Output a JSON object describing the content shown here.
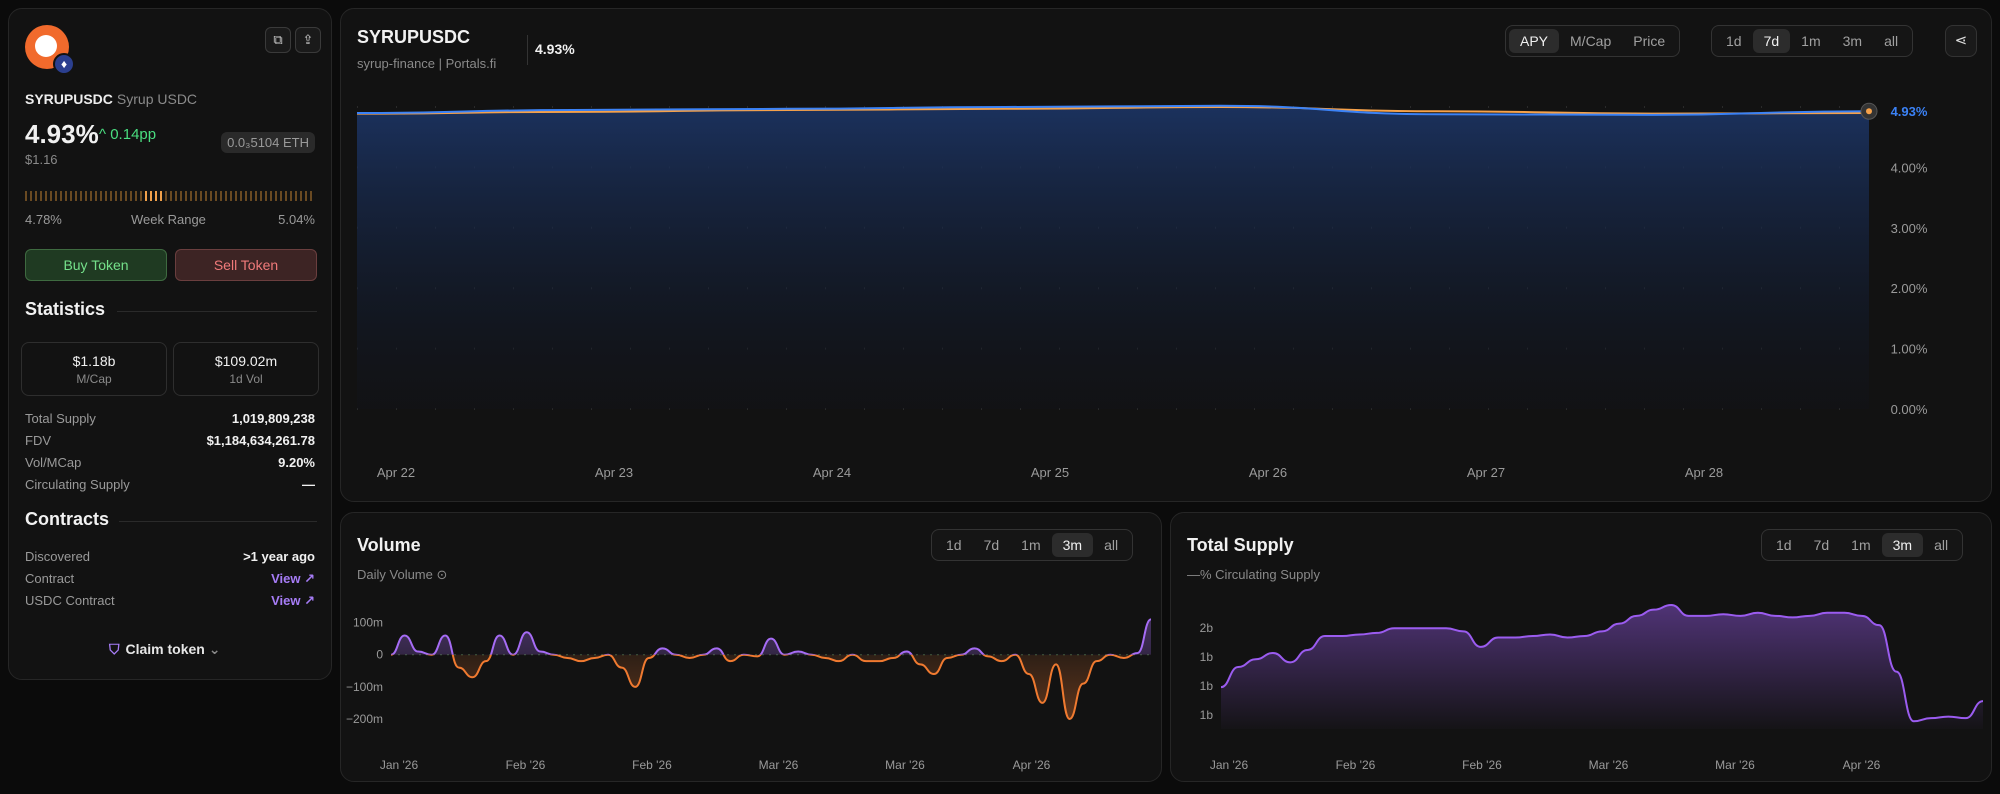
{
  "token": {
    "symbol": "SYRUPUSDC",
    "name": "Syrup USDC",
    "apy": "4.93%",
    "delta": "0.14pp",
    "price": "$1.16",
    "eth_price": "0.0₃5104 ETH",
    "week_low": "4.78%",
    "week_label": "Week Range",
    "week_high": "5.04%",
    "buy_label": "Buy Token",
    "sell_label": "Sell Token"
  },
  "statistics": {
    "heading": "Statistics",
    "mcap_value": "$1.18b",
    "mcap_label": "M/Cap",
    "vol_value": "$109.02m",
    "vol_label": "1d Vol",
    "rows": [
      {
        "k": "Total Supply",
        "v": "1,019,809,238"
      },
      {
        "k": "FDV",
        "v": "$1,184,634,261.78"
      },
      {
        "k": "Vol/MCap",
        "v": "9.20%"
      },
      {
        "k": "Circulating Supply",
        "v": "—"
      }
    ]
  },
  "contracts": {
    "heading": "Contracts",
    "rows": [
      {
        "k": "Discovered",
        "v": ">1 year ago"
      },
      {
        "k": "Contract",
        "v": "View ↗"
      },
      {
        "k": "USDC Contract",
        "v": "View ↗"
      }
    ],
    "claim_label": "Claim token"
  },
  "main_chart": {
    "title": "SYRUPUSDC",
    "subtitle": "syrup-finance | Portals.fi",
    "header_value": "4.93%",
    "metric_tabs": [
      "APY",
      "M/Cap",
      "Price"
    ],
    "metric_active": "APY",
    "range_tabs": [
      "1d",
      "7d",
      "1m",
      "3m",
      "all"
    ],
    "range_active": "7d",
    "current_label": "4.93%"
  },
  "volume": {
    "title": "Volume",
    "subtitle": "Daily Volume",
    "range_tabs": [
      "1d",
      "7d",
      "1m",
      "3m",
      "all"
    ],
    "range_active": "3m"
  },
  "supply": {
    "title": "Total Supply",
    "subtitle": "—% Circulating Supply",
    "range_tabs": [
      "1d",
      "7d",
      "1m",
      "3m",
      "all"
    ],
    "range_active": "3m"
  },
  "colors": {
    "apy_blue": "#3b82f6",
    "apy_orange": "#f5a14a",
    "volume_purple": "#a66cf5",
    "volume_orange": "#f07a30",
    "supply_purple": "#9b5cf0",
    "positive": "#4ade80"
  },
  "chart_data": [
    {
      "type": "line",
      "x": [
        "Apr 22",
        "Apr 23",
        "Apr 24",
        "Apr 25",
        "Apr 26",
        "Apr 27",
        "Apr 28",
        "Apr 28 end"
      ],
      "xticks": [
        "Apr 22",
        "Apr 23",
        "Apr 24",
        "Apr 25",
        "Apr 26",
        "Apr 27",
        "Apr 28"
      ],
      "yticks": [
        "4.00%",
        "3.00%",
        "2.00%",
        "1.00%",
        "0.00%"
      ],
      "ylim": [
        0,
        5
      ],
      "series": [
        {
          "values": [
            4.9,
            4.95,
            4.97,
            5.0,
            5.02,
            4.88,
            4.87,
            4.93
          ]
        },
        {
          "values": [
            4.89,
            4.92,
            4.95,
            4.97,
            5.0,
            4.93,
            4.89,
            4.9
          ]
        }
      ]
    },
    {
      "type": "area",
      "xticks": [
        "Jan '26",
        "Feb '26",
        "Feb '26",
        "Mar '26",
        "Mar '26",
        "Apr '26"
      ],
      "yticks": [
        "100m",
        "0",
        "−100m",
        "−200m"
      ],
      "ylim": [
        -250,
        130
      ],
      "values": [
        0,
        60,
        10,
        0,
        60,
        -40,
        -70,
        -20,
        60,
        0,
        70,
        10,
        0,
        -10,
        -20,
        -10,
        0,
        -40,
        -100,
        -10,
        20,
        0,
        -10,
        0,
        20,
        -20,
        0,
        -5,
        50,
        0,
        10,
        0,
        -10,
        -20,
        0,
        -20,
        -20,
        -10,
        10,
        -30,
        -60,
        -10,
        0,
        20,
        -5,
        -20,
        0,
        -60,
        -150,
        -30,
        -200,
        -90,
        -20,
        0,
        -10,
        5,
        110
      ]
    },
    {
      "type": "area",
      "xticks": [
        "Jan '26",
        "Feb '26",
        "Feb '26",
        "Mar '26",
        "Mar '26",
        "Apr '26"
      ],
      "yticks": [
        "2b",
        "1b",
        "1b",
        "1b"
      ],
      "ylim": [
        0.85,
        1.65
      ],
      "values": [
        1.12,
        1.25,
        1.3,
        1.34,
        1.28,
        1.36,
        1.45,
        1.45,
        1.46,
        1.47,
        1.5,
        1.5,
        1.5,
        1.5,
        1.48,
        1.38,
        1.44,
        1.44,
        1.45,
        1.46,
        1.44,
        1.45,
        1.48,
        1.53,
        1.58,
        1.62,
        1.65,
        1.58,
        1.58,
        1.59,
        1.58,
        1.6,
        1.58,
        1.57,
        1.58,
        1.6,
        1.6,
        1.58,
        1.52,
        1.22,
        0.9,
        0.92,
        0.93,
        0.92,
        1.03
      ]
    }
  ]
}
